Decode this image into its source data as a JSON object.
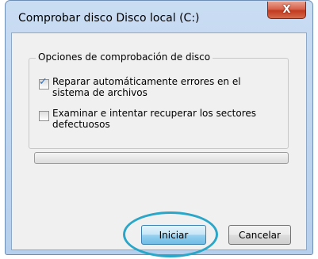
{
  "window": {
    "title": "Comprobar disco Disco local (C:)",
    "close_label": "X"
  },
  "options": {
    "group_label": "Opciones de comprobación de disco",
    "items": [
      {
        "label": "Reparar automáticamente errores en el sistema de archivos",
        "checked": true
      },
      {
        "label": "Examinar e intentar recuperar los sectores defectuosos",
        "checked": false
      }
    ]
  },
  "progress": {
    "value": 0
  },
  "buttons": {
    "start_label": "Iniciar",
    "cancel_label": "Cancelar"
  },
  "colors": {
    "highlight_ring": "#2aa7c8",
    "checkmark": "#2f6ec2"
  }
}
